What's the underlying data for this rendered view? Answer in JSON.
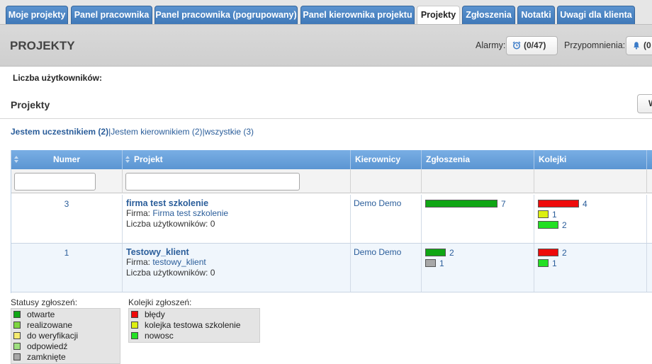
{
  "tabs": [
    {
      "label": "Moje projekty",
      "active": false
    },
    {
      "label": "Panel pracownika",
      "active": false
    },
    {
      "label": "Panel pracownika (pogrupowany)",
      "active": false
    },
    {
      "label": "Panel kierownika projektu",
      "active": false
    },
    {
      "label": "Projekty",
      "active": true
    },
    {
      "label": "Zgłoszenia",
      "active": false
    },
    {
      "label": "Notatki",
      "active": false
    },
    {
      "label": "Uwagi dla klienta",
      "active": false
    }
  ],
  "header": {
    "title": "PROJEKTY",
    "alarms_label": "Alarmy:",
    "alarms_value": "(0/47)",
    "reminders_label": "Przypomnienia:",
    "reminders_value": "(0"
  },
  "users_label": "Liczba użytkowników:",
  "section": {
    "title": "Projekty",
    "corner_button": "W"
  },
  "filters": {
    "participant": "Jestem uczestnikiem (2)",
    "manager": "Jestem kierownikiem (2)",
    "all": "wszystkie (3)",
    "separator": "|"
  },
  "table": {
    "columns": [
      "Numer",
      "Projekt",
      "Kierownicy",
      "Zgłoszenia",
      "Kolejki"
    ],
    "firm_label": "Firma:",
    "users_label": "Liczba użytkowników:",
    "rows": [
      {
        "number": "3",
        "name": "firma test szkolenie",
        "firm": "Firma test szkolenie",
        "users": "0",
        "manager": "Demo Demo",
        "tickets": [
          {
            "value": 7,
            "color": "#0fa614"
          }
        ],
        "queues": [
          {
            "value": 4,
            "color": "#ee0a0a"
          },
          {
            "value": 1,
            "color": "#dcef10"
          },
          {
            "value": 2,
            "color": "#23e023"
          }
        ]
      },
      {
        "number": "1",
        "name": "Testowy_klient",
        "firm": "testowy_klient",
        "users": "0",
        "manager": "Demo Demo",
        "tickets": [
          {
            "value": 2,
            "color": "#0fa614"
          },
          {
            "value": 1,
            "color": "#a8a8a8"
          }
        ],
        "queues": [
          {
            "value": 2,
            "color": "#ee0a0a"
          },
          {
            "value": 1,
            "color": "#23e023"
          }
        ]
      }
    ]
  },
  "legend_status": {
    "title": "Statusy zgłoszeń:",
    "items": [
      {
        "label": "otwarte",
        "color": "#0fa614"
      },
      {
        "label": "realizowane",
        "color": "#7ed640"
      },
      {
        "label": "do weryfikacji",
        "color": "#f6ec70"
      },
      {
        "label": "odpowiedź",
        "color": "#9fe080"
      },
      {
        "label": "zamknięte",
        "color": "#a8a8a8"
      }
    ]
  },
  "legend_queues": {
    "title": "Kolejki zgłoszeń:",
    "items": [
      {
        "label": "błędy",
        "color": "#ee0a0a"
      },
      {
        "label": "kolejka testowa szkolenie",
        "color": "#dcef10"
      },
      {
        "label": "nowosc",
        "color": "#23e023"
      }
    ]
  }
}
